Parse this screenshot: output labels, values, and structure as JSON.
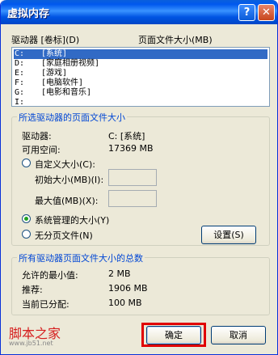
{
  "window": {
    "title": "虚拟内存"
  },
  "titlebar": {
    "help_label": "?",
    "close_label": "✕"
  },
  "drives": {
    "col_drive": "驱动器 [卷标](D)",
    "col_size": "页面文件大小(MB)",
    "items": [
      {
        "letter": "C:",
        "label": "[系统]",
        "selected": true
      },
      {
        "letter": "D:",
        "label": "[家庭相册视频]",
        "selected": false
      },
      {
        "letter": "E:",
        "label": "[游戏]",
        "selected": false
      },
      {
        "letter": "F:",
        "label": "[电脑软件]",
        "selected": false
      },
      {
        "letter": "G:",
        "label": "[电影和音乐]",
        "selected": false
      },
      {
        "letter": "I:",
        "label": "",
        "selected": false
      }
    ]
  },
  "selected_drive": {
    "title": "所选驱动器的页面文件大小",
    "drive_label": "驱动器:",
    "drive_value": "C:  [系统]",
    "space_label": "可用空间:",
    "space_value": "17369 MB",
    "custom_label": "自定义大小(C):",
    "initial_label": "初始大小(MB)(I):",
    "max_label": "最大值(MB)(X):",
    "initial_value": "",
    "max_value": "",
    "system_label": "系统管理的大小(Y)",
    "none_label": "无分页文件(N)",
    "set_button": "设置(S)",
    "selected_option": "system"
  },
  "totals": {
    "title": "所有驱动器页面文件大小的总数",
    "min_label": "允许的最小值:",
    "min_value": "2 MB",
    "recommended_label": "推荐:",
    "recommended_value": "1906 MB",
    "allocated_label": "当前已分配:",
    "allocated_value": "100 MB"
  },
  "footer": {
    "ok_label": "确定",
    "cancel_label": "取消",
    "watermark_logo": "脚本之家",
    "watermark_site": "www.jb51.net"
  },
  "colors": {
    "accent": "#316ac5",
    "highlight_box": "#e00000",
    "group_title": "#0046d5"
  }
}
